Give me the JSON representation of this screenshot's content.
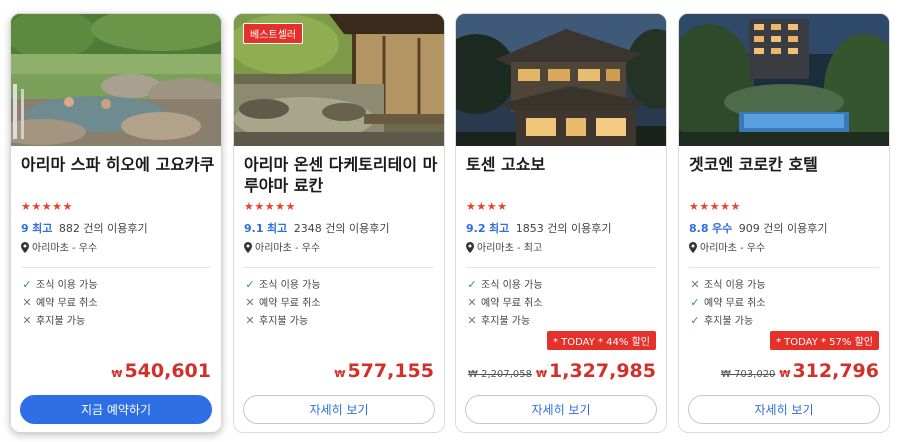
{
  "cards": [
    {
      "name": "아리마 스파 히오에 고요카쿠",
      "stars": "★★★★★",
      "score": "9",
      "score_word": "최고",
      "reviews": "882 건의 이용후기",
      "location": "아리마초 - 우수",
      "features": [
        {
          "label": "조식 이용 가능",
          "mark": "✓",
          "available": true
        },
        {
          "label": "예약 무료 취소",
          "mark": "✕",
          "available": false
        },
        {
          "label": "후지불 가능",
          "mark": "✕",
          "available": false
        }
      ],
      "badge": "",
      "deal": "",
      "original_price": "",
      "currency": "₩",
      "price": "540,601",
      "button": "지금 예약하기"
    },
    {
      "name": "아리마 온센 다케토리테이 마루야마 료칸",
      "stars": "★★★★★",
      "score": "9.1",
      "score_word": "최고",
      "reviews": "2348 건의 이용후기",
      "location": "아리마초 - 우수",
      "features": [
        {
          "label": "조식 이용 가능",
          "mark": "✓",
          "available": true
        },
        {
          "label": "예약 무료 취소",
          "mark": "✕",
          "available": false
        },
        {
          "label": "후지불 가능",
          "mark": "✕",
          "available": false
        }
      ],
      "badge": "베스트셀러",
      "deal": "",
      "original_price": "",
      "currency": "₩",
      "price": "577,155",
      "button": "자세히 보기"
    },
    {
      "name": "토센 고쇼보",
      "stars": "★★★★",
      "score": "9.2",
      "score_word": "최고",
      "reviews": "1853 건의 이용후기",
      "location": "아리마초 - 최고",
      "features": [
        {
          "label": "조식 이용 가능",
          "mark": "✓",
          "available": true
        },
        {
          "label": "예약 무료 취소",
          "mark": "✕",
          "available": false
        },
        {
          "label": "후지불 가능",
          "mark": "✕",
          "available": false
        }
      ],
      "badge": "",
      "deal": "* TODAY * 44% 할인",
      "original_price": "₩ 2,207,058",
      "currency": "₩",
      "price": "1,327,985",
      "button": "자세히 보기"
    },
    {
      "name": "겟코엔 코로칸 호텔",
      "stars": "★★★★★",
      "score": "8.8",
      "score_word": "우수",
      "reviews": "909 건의 이용후기",
      "location": "아리마초 - 우수",
      "features": [
        {
          "label": "조식 이용 가능",
          "mark": "✕",
          "available": false
        },
        {
          "label": "예약 무료 취소",
          "mark": "✓",
          "available": true
        },
        {
          "label": "후지불 가능",
          "mark": "✓",
          "available": true
        }
      ],
      "badge": "",
      "deal": "* TODAY * 57% 할인",
      "original_price": "₩ 703,020",
      "currency": "₩",
      "price": "312,796",
      "button": "자세히 보기"
    }
  ],
  "colors": {
    "accent": "#2d6ee4",
    "price": "#d3302a",
    "badge": "#e4322b",
    "check": "#2a9b3e",
    "stars": "#e8442b"
  }
}
